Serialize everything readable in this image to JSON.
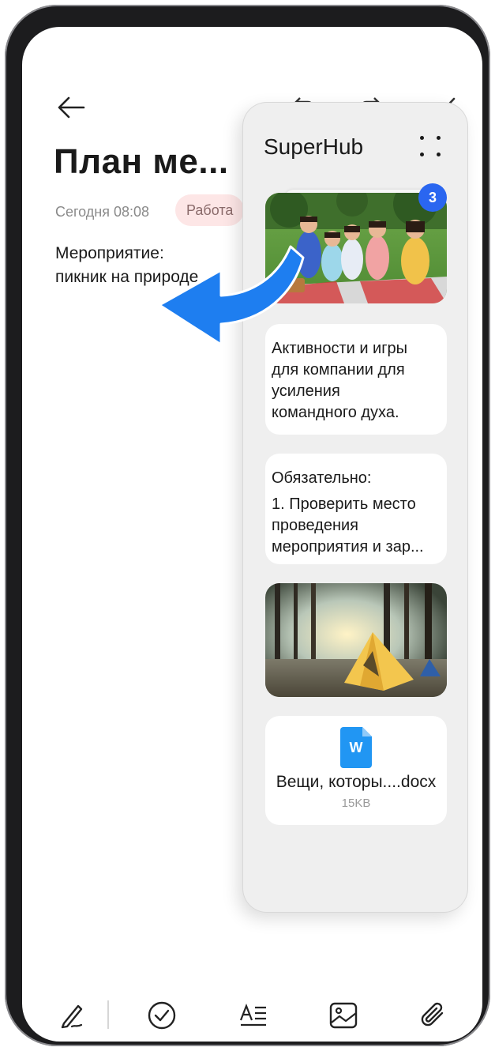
{
  "note": {
    "title": "План ме...",
    "date": "Сегодня 08:08",
    "tag": "Работа",
    "body_lines": [
      "Мероприятие:",
      "пикник на природе"
    ]
  },
  "superhub": {
    "title": "SuperHub",
    "badge_count": "3",
    "text_card_1": [
      "Активности и игры",
      "для компании для",
      "усиления",
      "командного духа."
    ],
    "text_card_2": [
      "Обязательно:",
      "1. Проверить место",
      "проведения",
      "мероприятия и зар..."
    ],
    "doc_card": {
      "icon_letter": "W",
      "name": "Вещи, которы....docx",
      "size": "15KB"
    }
  },
  "toolbar_icons": [
    "handwriting-icon",
    "checklist-icon",
    "text-format-icon",
    "image-icon",
    "attachment-icon"
  ],
  "colors": {
    "accent": "#2a66f0",
    "arrow": "#1e7ef0",
    "tag_bg": "#fde6e6",
    "doc_icon": "#2196f3"
  }
}
